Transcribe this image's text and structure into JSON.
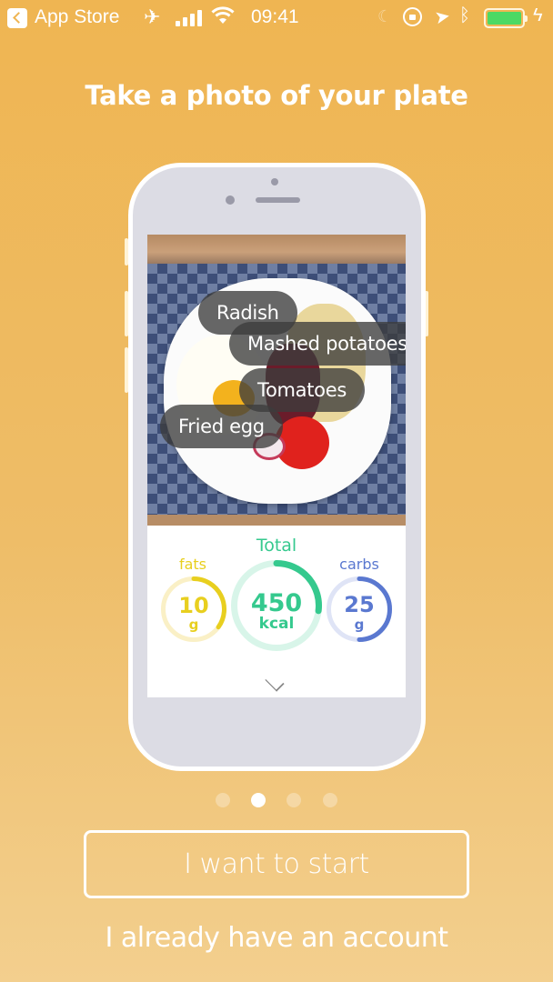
{
  "status_bar": {
    "back_app": "App Store",
    "time": "09:41",
    "icons": [
      "back-chevron-icon",
      "airplane-icon",
      "signal-icon",
      "wifi-icon",
      "moon-icon",
      "rotation-lock-icon",
      "location-icon",
      "bluetooth-icon",
      "battery-icon",
      "charging-bolt-icon"
    ],
    "battery_level": 1.0
  },
  "onboarding": {
    "title": "Take a photo of your plate",
    "food_tags": [
      "Radish",
      "Mashed potatoes",
      "Tomatoes",
      "Fried egg"
    ],
    "macros": {
      "fats": {
        "label": "fats",
        "value": "10",
        "unit": "g",
        "progress": 0.35,
        "color": "#e8cf1f",
        "track": "#faf0c6"
      },
      "total": {
        "label": "Total",
        "value": "450",
        "unit": "kcal",
        "progress": 0.27,
        "color": "#35c98e",
        "track": "#d8f5e9"
      },
      "carbs": {
        "label": "carbs",
        "value": "25",
        "unit": "g",
        "progress": 0.5,
        "color": "#5a78d0",
        "track": "#dfe4f6"
      }
    },
    "page_indicator": {
      "count": 4,
      "active": 1
    },
    "primary_button": "I want to start",
    "secondary_link": "I already have an account"
  }
}
